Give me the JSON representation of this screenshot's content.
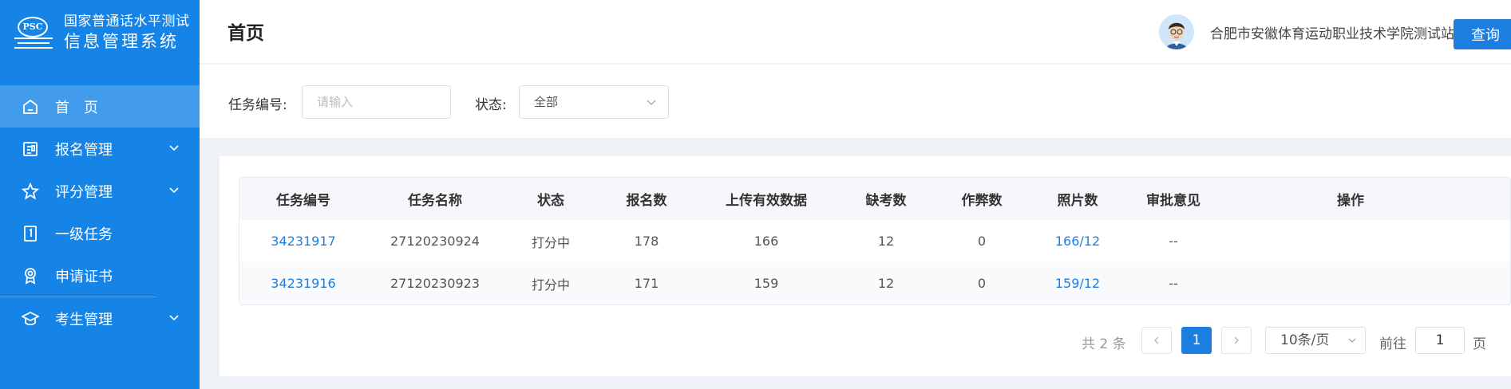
{
  "app": {
    "logo_badge": "PSC",
    "title_line1": "国家普通话水平测试",
    "title_line2": "信息管理系统"
  },
  "sidebar": {
    "items": [
      {
        "label": "首　页",
        "icon": "home-icon",
        "active": true
      },
      {
        "label": "报名管理",
        "icon": "registration-icon",
        "expandable": true
      },
      {
        "label": "评分管理",
        "icon": "star-icon",
        "expandable": true
      },
      {
        "label": "一级任务",
        "icon": "task-icon"
      },
      {
        "label": "申请证书",
        "icon": "certificate-icon"
      },
      {
        "label": "考生管理",
        "icon": "graduation-cap-icon",
        "expandable": true
      }
    ]
  },
  "header": {
    "title": "首页",
    "user_name": "合肥市安徽体育运动职业技术学院测试站管理员"
  },
  "filter": {
    "task_id_label": "任务编号:",
    "task_id_placeholder": "请输入",
    "status_label": "状态:",
    "status_value": "全部",
    "query_button": "查询"
  },
  "table": {
    "columns": [
      "任务编号",
      "任务名称",
      "状态",
      "报名数",
      "上传有效数据",
      "缺考数",
      "作弊数",
      "照片数",
      "审批意见",
      "操作"
    ],
    "rows": [
      {
        "task_id": "34231917",
        "task_name": "27120230924",
        "status": "打分中",
        "registered": "178",
        "valid_uploads": "166",
        "absent": "12",
        "cheating": "0",
        "photos": "166/12",
        "approval": "--",
        "action": ""
      },
      {
        "task_id": "34231916",
        "task_name": "27120230923",
        "status": "打分中",
        "registered": "171",
        "valid_uploads": "159",
        "absent": "12",
        "cheating": "0",
        "photos": "159/12",
        "approval": "--",
        "action": ""
      }
    ]
  },
  "pagination": {
    "total": "共 2 条",
    "current_page": "1",
    "page_size": "10条/页",
    "goto_label": "前往",
    "goto_value": "1",
    "goto_unit": "页"
  },
  "colors": {
    "sidebar_bg": "#1584e6",
    "accent": "#1c7fe0",
    "page_bg": "#eef1f5"
  }
}
